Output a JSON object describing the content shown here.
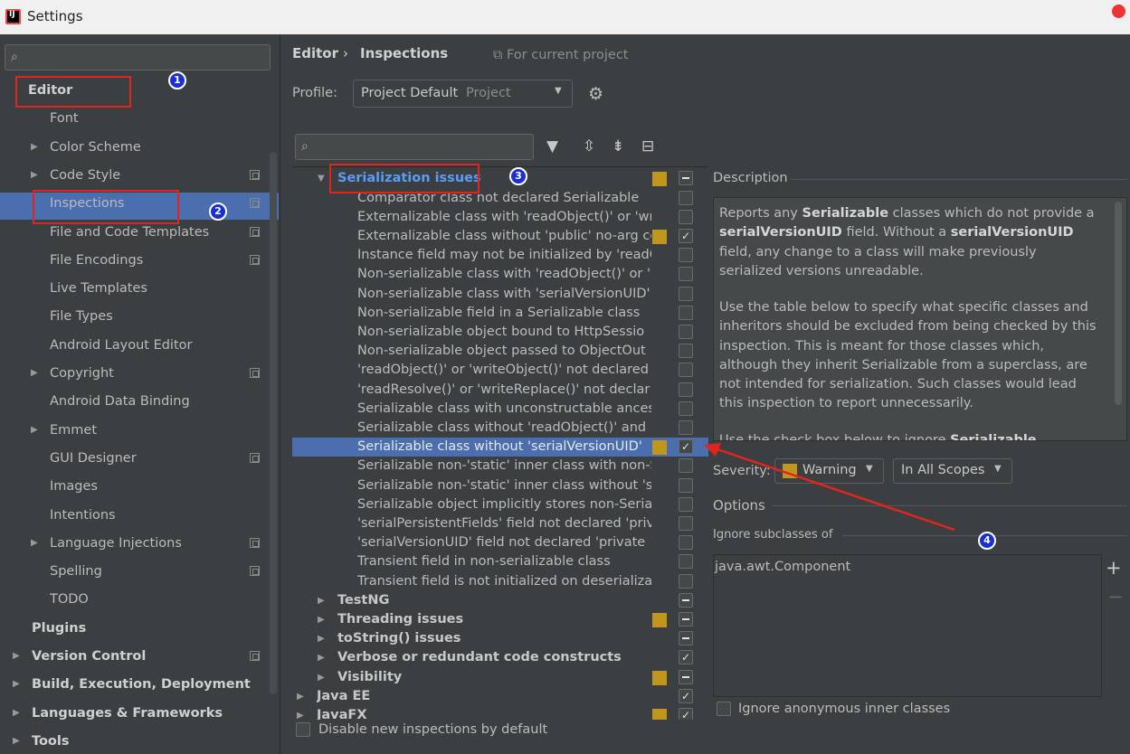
{
  "window": {
    "title": "Settings",
    "icon": "intellij-app-icon"
  },
  "sidebar": {
    "search_placeholder": "",
    "items": [
      {
        "label": "Editor",
        "bold": true
      },
      {
        "label": "Font"
      },
      {
        "label": "Color Scheme",
        "expandable": true
      },
      {
        "label": "Code Style",
        "expandable": true,
        "project_icon": true
      },
      {
        "label": "Inspections",
        "selected": true,
        "project_icon": true
      },
      {
        "label": "File and Code Templates",
        "project_icon": true
      },
      {
        "label": "File Encodings",
        "project_icon": true
      },
      {
        "label": "Live Templates"
      },
      {
        "label": "File Types"
      },
      {
        "label": "Android Layout Editor"
      },
      {
        "label": "Copyright",
        "expandable": true,
        "project_icon": true
      },
      {
        "label": "Android Data Binding"
      },
      {
        "label": "Emmet",
        "expandable": true
      },
      {
        "label": "GUI Designer",
        "project_icon": true
      },
      {
        "label": "Images"
      },
      {
        "label": "Intentions"
      },
      {
        "label": "Language Injections",
        "expandable": true,
        "project_icon": true
      },
      {
        "label": "Spelling",
        "project_icon": true
      },
      {
        "label": "TODO"
      },
      {
        "label": "Plugins",
        "bold": true
      },
      {
        "label": "Version Control",
        "bold": true,
        "expandable": true,
        "project_icon": true
      },
      {
        "label": "Build, Execution, Deployment",
        "bold": true,
        "expandable": true
      },
      {
        "label": "Languages & Frameworks",
        "bold": true,
        "expandable": true
      },
      {
        "label": "Tools",
        "bold": true,
        "expandable": true
      }
    ]
  },
  "annotations": [
    "1",
    "2",
    "3",
    "4"
  ],
  "header": {
    "breadcrumb": [
      "Editor",
      "Inspections"
    ],
    "separator": "›",
    "scope_note": "For current project"
  },
  "profile": {
    "label": "Profile:",
    "value": "Project Default",
    "hint": "Project"
  },
  "tree": {
    "search_placeholder": "",
    "toolbar": [
      "filter-icon",
      "expand-all-icon",
      "collapse-all-icon",
      "reset-icon"
    ],
    "group_title": "Serialization issues",
    "rows": [
      {
        "label": "Comparator class not declared Serializable",
        "checked": "off"
      },
      {
        "label": "Externalizable class with 'readObject()' or 'wr",
        "checked": "off"
      },
      {
        "label": "Externalizable class without 'public' no-arg cc",
        "checked": "on",
        "severity": true
      },
      {
        "label": "Instance field may not be initialized by 'readC",
        "checked": "off"
      },
      {
        "label": "Non-serializable class with 'readObject()' or '",
        "checked": "off"
      },
      {
        "label": "Non-serializable class with 'serialVersionUID'",
        "checked": "off"
      },
      {
        "label": "Non-serializable field in a Serializable class",
        "checked": "off"
      },
      {
        "label": "Non-serializable object bound to HttpSessio",
        "checked": "off"
      },
      {
        "label": "Non-serializable object passed to ObjectOut",
        "checked": "off"
      },
      {
        "label": "'readObject()' or 'writeObject()' not declared",
        "checked": "off"
      },
      {
        "label": "'readResolve()' or 'writeReplace()' not declar",
        "checked": "off"
      },
      {
        "label": "Serializable class with unconstructable ances",
        "checked": "off"
      },
      {
        "label": "Serializable class without 'readObject()' and '",
        "checked": "off"
      },
      {
        "label": "Serializable class without 'serialVersionUID'",
        "checked": "on",
        "severity": true,
        "selected": true
      },
      {
        "label": "Serializable non-'static' inner class with non-S",
        "checked": "off"
      },
      {
        "label": "Serializable non-'static' inner class without 'se",
        "checked": "off"
      },
      {
        "label": "Serializable object implicitly stores non-Seria",
        "checked": "off"
      },
      {
        "label": "'serialPersistentFields' field not declared 'priv",
        "checked": "off"
      },
      {
        "label": "'serialVersionUID' field not declared 'private",
        "checked": "off"
      },
      {
        "label": "Transient field in non-serializable class",
        "checked": "off"
      },
      {
        "label": "Transient field is not initialized on deserializa",
        "checked": "off"
      }
    ],
    "groups_after": [
      {
        "label": "TestNG",
        "checked": "mixed"
      },
      {
        "label": "Threading issues",
        "checked": "mixed",
        "severity": true
      },
      {
        "label": "toString() issues",
        "checked": "mixed"
      },
      {
        "label": "Verbose or redundant code constructs",
        "checked": "on"
      },
      {
        "label": "Visibility",
        "checked": "mixed",
        "severity": true
      }
    ],
    "top_groups": [
      {
        "label": "Java EE",
        "checked": "on"
      },
      {
        "label": "JavaFX",
        "checked": "on",
        "severity": true
      }
    ],
    "disable_new": "Disable new inspections by default"
  },
  "description": {
    "title": "Description",
    "p1_a": "Reports any ",
    "p1_b": "Serializable",
    "p1_c": " classes which do not provide a ",
    "p1_d": "serialVersionUID",
    "p1_e": " field. Without a ",
    "p1_f": "serialVersionUID",
    "p1_g": " field, any change to a class will make previously serialized versions unreadable.",
    "p2": "Use the table below to specify what specific classes and inheritors should be excluded from being checked by this inspection. This is meant for those classes which, although they inherit Serializable from a superclass, are not intended for serialization. Such classes would lead this inspection to report unnecessarily.",
    "p3_a": "Use the check box below to ignore ",
    "p3_b": "Serializable"
  },
  "severity": {
    "label": "Severity:",
    "value": "Warning",
    "scope": "In All Scopes",
    "color": "#c0971c"
  },
  "options": {
    "title": "Options",
    "ignore_title": "Ignore subclasses of",
    "ignore_items": [
      "java.awt.Component"
    ],
    "anonymous_label": "Ignore anonymous inner classes"
  },
  "colors": {
    "selection": "#4b6eaf",
    "annotation_red": "#e0241e",
    "badge_blue": "#1c2fcf",
    "background": "#3c3f41"
  }
}
